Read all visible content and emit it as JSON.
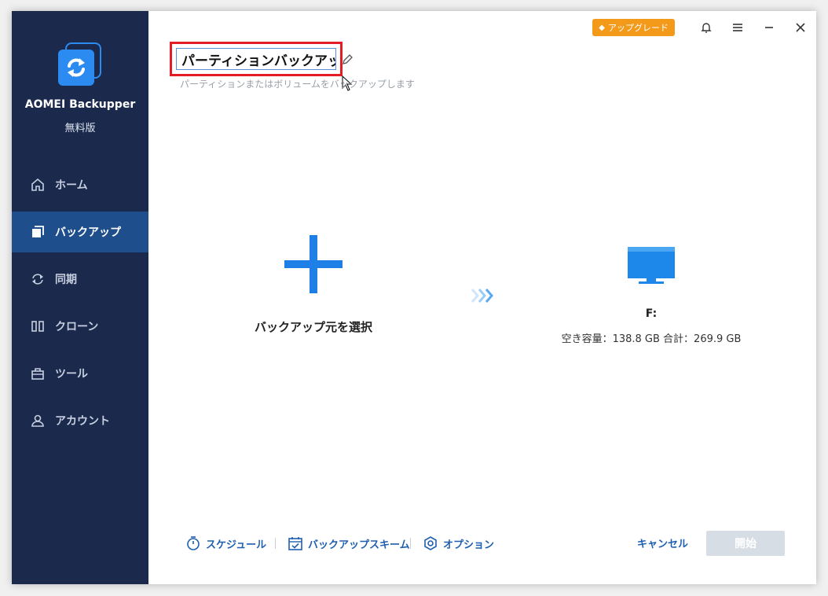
{
  "app": {
    "name": "AOMEI Backupper",
    "edition": "無料版"
  },
  "sidebar": {
    "items": [
      {
        "label": "ホーム",
        "icon": "home-icon",
        "active": false
      },
      {
        "label": "バックアップ",
        "icon": "backup-icon",
        "active": true
      },
      {
        "label": "同期",
        "icon": "sync-icon",
        "active": false
      },
      {
        "label": "クローン",
        "icon": "clone-icon",
        "active": false
      },
      {
        "label": "ツール",
        "icon": "toolbox-icon",
        "active": false
      },
      {
        "label": "アカウント",
        "icon": "user-icon",
        "active": false
      }
    ]
  },
  "titlebar": {
    "upgrade_label": "アップグレード"
  },
  "task": {
    "name": "パーティションバックアップ",
    "description": "パーティションまたはボリュームをバックアップします"
  },
  "source": {
    "label": "バックアップ元を選択"
  },
  "destination": {
    "label": "F:",
    "capacity": "空き容量：138.8 GB 合計：269.9 GB"
  },
  "bottom": {
    "schedule_label": "スケジュール",
    "scheme_label": "バックアップスキーム",
    "options_label": "オプション",
    "cancel_label": "キャンセル",
    "start_label": "開始"
  },
  "colors": {
    "sidebar_bg": "#1b2a4c",
    "sidebar_active": "#1f4e8c",
    "accent": "#2c8bf0",
    "upgrade": "#f39a1b",
    "highlight_border": "#e31c25",
    "link": "#1f5fb0"
  }
}
